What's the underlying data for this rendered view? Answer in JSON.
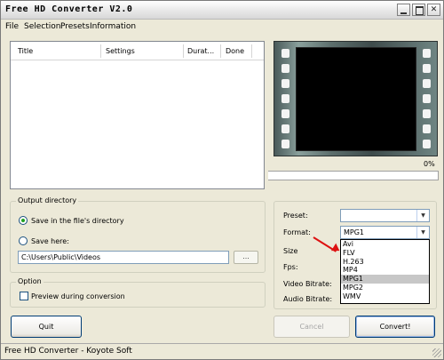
{
  "window": {
    "title": "Free HD Converter V2.0"
  },
  "menu": {
    "file": "File",
    "selection": "Selection",
    "presets": "Presets",
    "information": "Information"
  },
  "list": {
    "columns": [
      "Title",
      "Settings",
      "Durat...",
      "Done"
    ]
  },
  "progress": {
    "percent_label": "0%",
    "value": 0
  },
  "output": {
    "group_label": "Output directory",
    "radio_same": "Save in the file's directory",
    "radio_here": "Save here:",
    "path": "C:\\Users\\Public\\Videos",
    "browse": "..."
  },
  "option": {
    "group_label": "Option",
    "preview": "Preview during conversion"
  },
  "settings": {
    "preset_label": "Preset:",
    "preset_value": "",
    "format_label": "Format:",
    "format_value": "MPG1",
    "size_label": "Size",
    "fps_label": "Fps:",
    "video_bitrate_label": "Video Bitrate:",
    "audio_bitrate_label": "Audio Bitrate:",
    "format_options": [
      "Avi",
      "FLV",
      "H.263",
      "MP4",
      "MPG1",
      "MPG2",
      "WMV"
    ],
    "selected_option": "MPG1"
  },
  "buttons": {
    "quit": "Quit",
    "cancel": "Cancel",
    "convert": "Convert!"
  },
  "statusbar": {
    "text": "Free HD Converter - Koyote Soft"
  }
}
